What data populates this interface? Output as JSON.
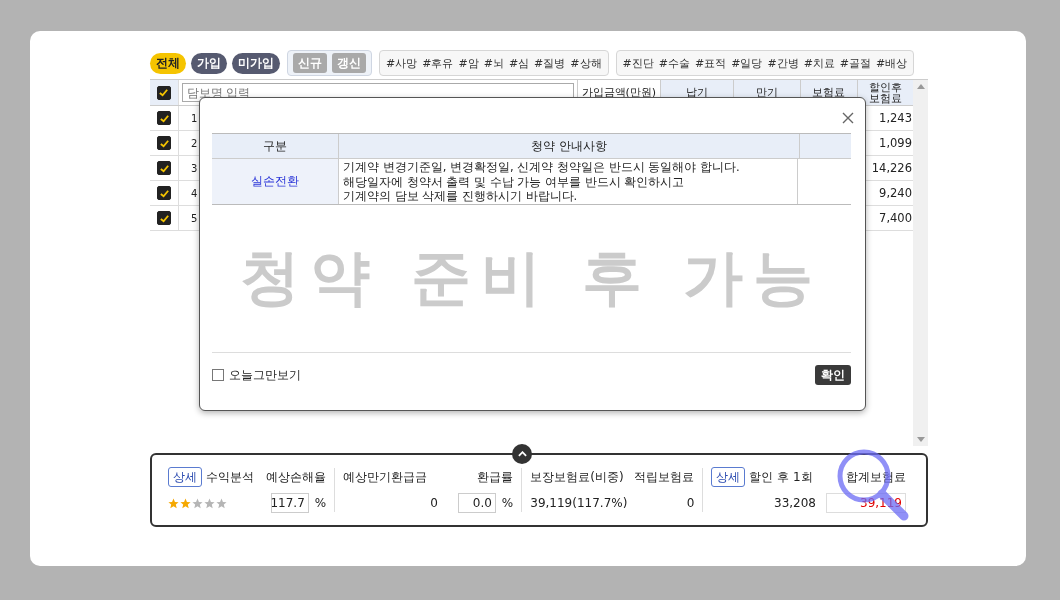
{
  "filters": {
    "status": [
      {
        "label": "전체",
        "selected": true
      },
      {
        "label": "가입",
        "selected": false
      },
      {
        "label": "미가입",
        "selected": false
      }
    ],
    "types": [
      {
        "label": "신규",
        "selected": false
      },
      {
        "label": "갱신",
        "selected": false
      }
    ],
    "tag_groups": [
      [
        "#사망",
        "#후유",
        "#암",
        "#뇌",
        "#심",
        "#질병",
        "#상해"
      ],
      [
        "#진단",
        "#수술",
        "#표적",
        "#일당",
        "#간병",
        "#치료",
        "#골절",
        "#배상"
      ]
    ]
  },
  "table": {
    "all_checked": true,
    "search_placeholder": "담보명 입력",
    "columns": [
      "가입금액(만원)",
      "납기",
      "만기",
      "보험료",
      "할인후 보험료"
    ],
    "rows": [
      {
        "no": "1",
        "checked": true,
        "discounted": "1,243"
      },
      {
        "no": "2",
        "checked": true,
        "discounted": "1,099"
      },
      {
        "no": "3",
        "checked": true,
        "discounted": "14,226"
      },
      {
        "no": "4",
        "checked": true,
        "discounted": "9,240"
      },
      {
        "no": "5",
        "checked": true,
        "discounted": "7,400"
      }
    ]
  },
  "modal": {
    "columns": [
      "구분",
      "청약 안내사항"
    ],
    "rows": [
      {
        "category": "실손전환",
        "notice": "기계약 변경기준일, 변경확정일, 신계약 청약일은 반드시 동일해야 합니다.\n해당일자에 청약서 출력 및 수납 가능 여부를 반드시 확인하시고\n기계약의 담보 삭제를 진행하시기 바랍니다."
      }
    ],
    "stamp": "청약 준비 후 가능",
    "dont_show_today": {
      "label": "오늘그만보기",
      "checked": false
    },
    "confirm": "확인"
  },
  "summary": {
    "detail_button": "상세",
    "profit_analysis": "수익분석",
    "stars": 2,
    "loss_ratio_label": "예상손해율",
    "loss_ratio": "117.7",
    "percent_1": "%",
    "maturity_refund_label": "예상만기환급금",
    "maturity_refund": "0",
    "refund_rate_label": "환급률",
    "refund_rate": "0.0",
    "percent_2": "%",
    "coverage_premium_label": "보장보험료(비중)",
    "coverage_premium": "39,119(117.7%)",
    "savings_premium_label": "적립보험료",
    "savings_premium": "0",
    "detail_button_2": "상세",
    "discount_label": "할인 후 1회",
    "discount_value": "33,208",
    "total_label": "합계보험료",
    "total_value": "39,119"
  }
}
